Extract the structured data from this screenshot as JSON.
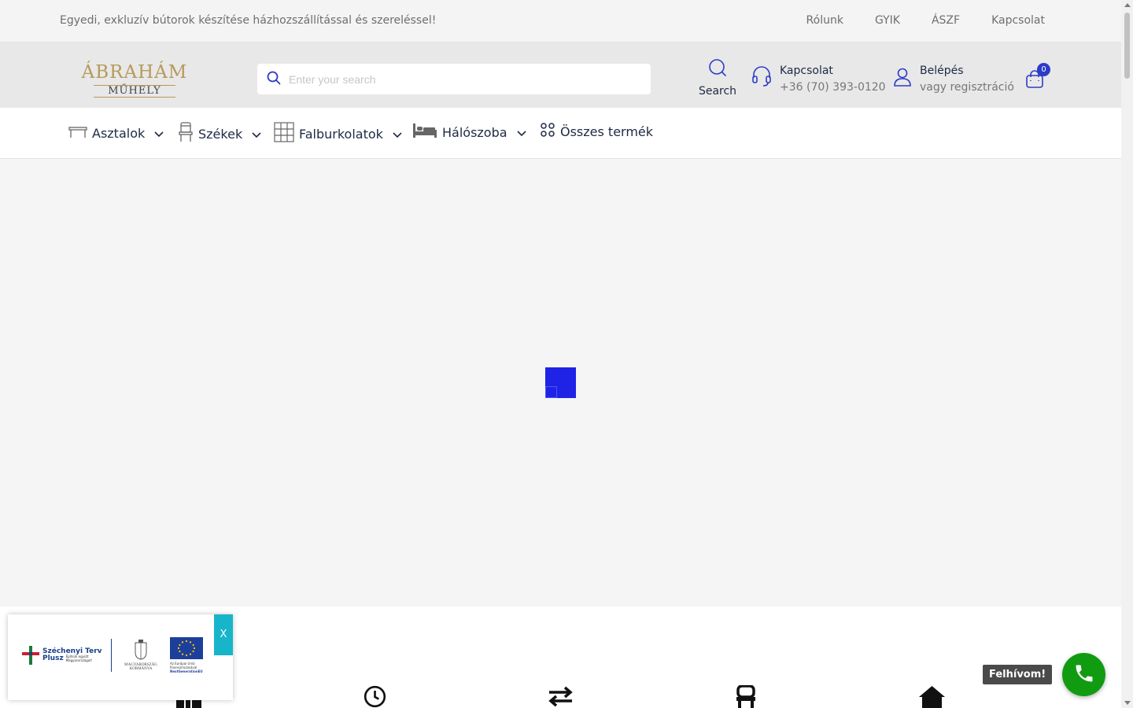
{
  "topbar": {
    "tagline": "Egyedi, exkluzív bútorok készítése házhozszállítással és szereléssel!",
    "links": [
      "Rólunk",
      "GYIK",
      "ÁSZF",
      "Kapcsolat"
    ]
  },
  "header": {
    "logo_line1": "ÁBRAHÁM",
    "logo_line2": "MŰHELY",
    "search_placeholder": "Enter your search",
    "search_label": "Search",
    "contact_title": "Kapcsolat",
    "contact_phone": "+36 (70) 393-0120",
    "login_title": "Belépés",
    "login_subtitle": "vagy regisztráció",
    "cart_count": "0"
  },
  "nav": {
    "items": [
      "Asztalok",
      "Székek",
      "Falburkolatok",
      "Hálószoba",
      "Összes termék"
    ]
  },
  "banner": {
    "close_label": "X",
    "szechenyi_title": "Széchenyi Terv",
    "szechenyi_sub": "Plusz",
    "szechenyi_tag": "Építsük együtt Magyarországot!",
    "gov_label": "MAGYARORSZÁG KORMÁNYA",
    "eu_label": "Az Európai Unió finanszírozásával",
    "eu_sub": "NextGenerationEU"
  },
  "call": {
    "label": "Felhívom!"
  },
  "colors": {
    "accent": "#2c3cc7",
    "loader": "#1e23e6",
    "call_green": "#119b11",
    "banner_close": "#17b5c9",
    "logo_gold": "#b59a5a"
  }
}
